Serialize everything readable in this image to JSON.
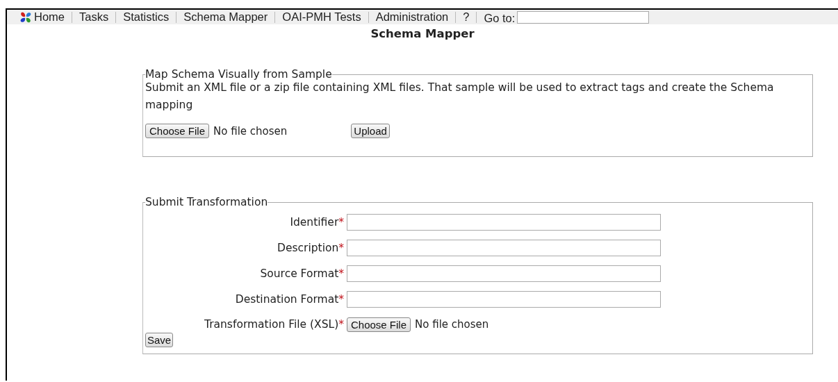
{
  "nav": {
    "items": [
      {
        "label": "Home",
        "icon": true
      },
      {
        "label": "Tasks"
      },
      {
        "label": "Statistics"
      },
      {
        "label": "Schema Mapper"
      },
      {
        "label": "OAI-PMH Tests"
      },
      {
        "label": "Administration"
      },
      {
        "label": "?"
      }
    ],
    "goto_label": "Go to:"
  },
  "page_title": "Schema Mapper",
  "sample_section": {
    "legend": "Map Schema Visually from Sample",
    "description": "Submit an XML file or a zip file containing XML files. That sample will be used to extract tags and create the Schema mapping",
    "file_button": "Choose File",
    "file_status": "No file chosen",
    "upload_button": "Upload"
  },
  "transform_section": {
    "legend": "Submit Transformation",
    "fields": [
      {
        "kind": "text",
        "label": "Identifier",
        "required_mark": "*"
      },
      {
        "kind": "text",
        "label": "Description",
        "required_mark": "*"
      },
      {
        "kind": "text",
        "label": "Source Format",
        "required_mark": "*"
      },
      {
        "kind": "text",
        "label": "Destination Format",
        "required_mark": "*"
      },
      {
        "kind": "file",
        "label": "Transformation File (XSL)",
        "required_mark": "*",
        "file_button": "Choose File",
        "file_status": "No file chosen"
      }
    ],
    "save_button": "Save"
  }
}
